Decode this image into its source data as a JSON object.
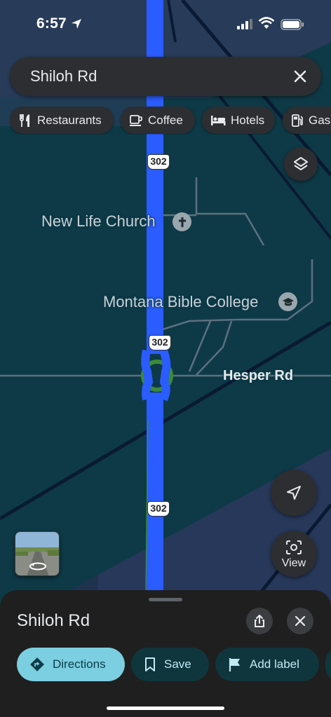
{
  "status_bar": {
    "time": "6:57"
  },
  "search": {
    "query": "Shiloh Rd"
  },
  "chips": [
    {
      "label": "Restaurants",
      "icon": "fork-knife-icon"
    },
    {
      "label": "Coffee",
      "icon": "coffee-cup-icon"
    },
    {
      "label": "Hotels",
      "icon": "bed-icon"
    },
    {
      "label": "Gas",
      "icon": "gas-pump-icon"
    }
  ],
  "map": {
    "places": {
      "church": "New Life Church",
      "college": "Montana Bible College"
    },
    "road_label": "Hesper Rd",
    "route_shields": [
      "302",
      "302",
      "302"
    ],
    "colors": {
      "background": "#0e3a47",
      "land": "#1f3d55",
      "highlighted_road": "#2a5cff",
      "roads": "#5c7080",
      "dark_roads": "#0a1a33"
    }
  },
  "controls": {
    "view_label": "View"
  },
  "sheet": {
    "title": "Shiloh Rd",
    "actions": [
      {
        "label": "Directions",
        "icon": "directions-icon"
      },
      {
        "label": "Save",
        "icon": "bookmark-icon"
      },
      {
        "label": "Add label",
        "icon": "flag-icon"
      }
    ]
  }
}
